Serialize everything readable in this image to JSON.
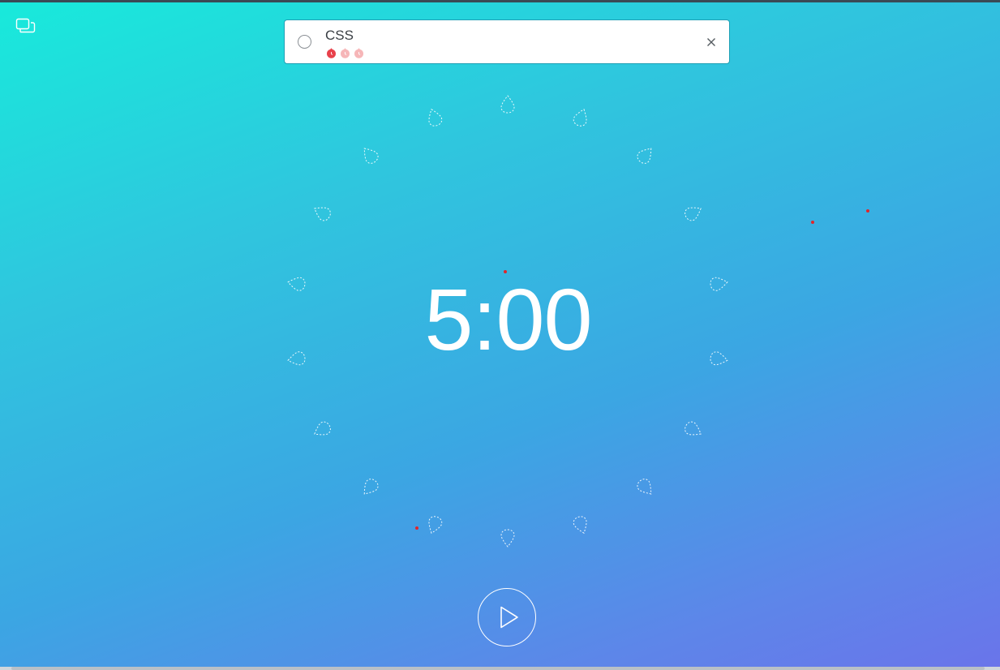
{
  "colors": {
    "gradient_start": "#18eadb",
    "gradient_end": "#6a74ea",
    "tomato_active": "#e8414b",
    "tomato_inactive": "#f6b6b8",
    "card_border": "#1ea0b5"
  },
  "toolbar": {
    "mini_mode_icon": "mini-window-icon"
  },
  "task": {
    "title": "CSS",
    "pomodoros_completed": 1,
    "pomodoros_total": 3,
    "check_icon": "circle-check-icon",
    "close_icon": "close-icon"
  },
  "timer": {
    "display": "5:00"
  },
  "controls": {
    "play_icon": "play-icon"
  }
}
